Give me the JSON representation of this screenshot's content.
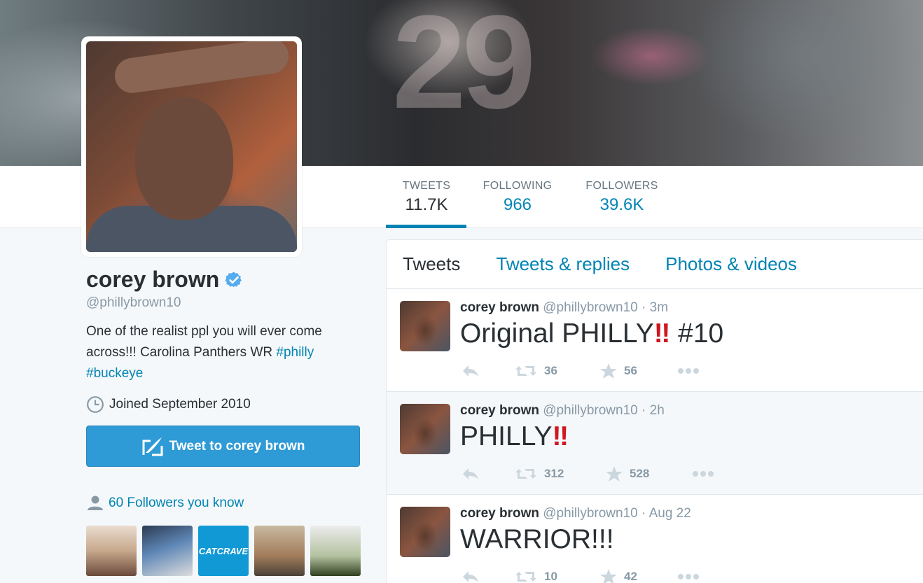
{
  "banner": {
    "number": "29"
  },
  "stats": [
    {
      "label": "TWEETS",
      "value": "11.7K"
    },
    {
      "label": "FOLLOWING",
      "value": "966"
    },
    {
      "label": "FOLLOWERS",
      "value": "39.6K"
    }
  ],
  "profile": {
    "name": "corey brown",
    "handle": "@phillybrown10",
    "bio_text": "One of the realist ppl you will ever come across!!! Carolina Panthers WR ",
    "bio_tag1": "#philly",
    "bio_tag2": "#buckeye",
    "joined": "Joined September 2010",
    "tweet_to_label": "Tweet to corey brown",
    "followers_you_know": "60 Followers you know",
    "thumb3_label": "CATCRAVE"
  },
  "tabs": [
    "Tweets",
    "Tweets & replies",
    "Photos & videos"
  ],
  "tweets": [
    {
      "name": "corey brown",
      "handle": "@phillybrown10",
      "time": "· 3m",
      "text_before": "Original PHILLY",
      "text_bang": "‼",
      "text_after": " #10",
      "retweets": "36",
      "favorites": "56"
    },
    {
      "name": "corey brown",
      "handle": "@phillybrown10",
      "time": "· 2h",
      "text_before": "PHILLY",
      "text_bang": "‼",
      "text_after": "",
      "retweets": "312",
      "favorites": "528"
    },
    {
      "name": "corey brown",
      "handle": "@phillybrown10",
      "time": "· Aug 22",
      "text_before": "WARRIOR!!!",
      "text_bang": "",
      "text_after": "",
      "retweets": "10",
      "favorites": "42"
    }
  ],
  "colors": {
    "link": "#0084b4",
    "button": "#2f9bd6",
    "verified": "#55acee",
    "exclaim": "#d0171f"
  }
}
